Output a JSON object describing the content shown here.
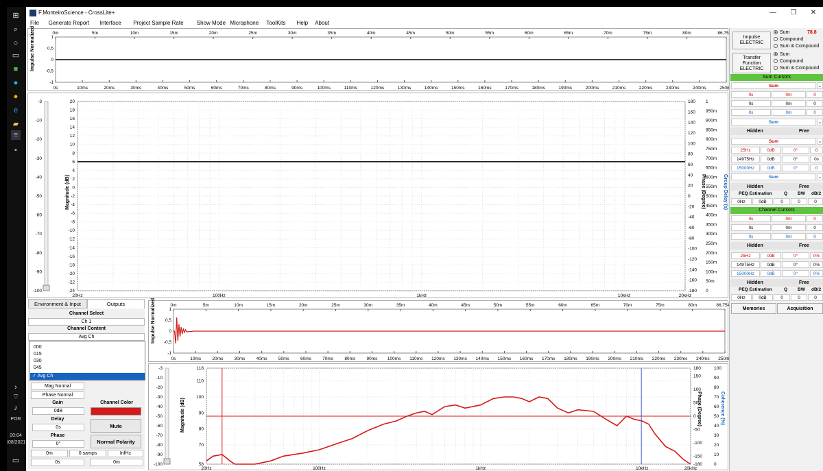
{
  "window": {
    "title": "F.MonteiroScience - CrossLite+"
  },
  "taskbar": {
    "language": "POR",
    "time": "20:04",
    "date": "/08/2021"
  },
  "menu": [
    "File",
    "Generate Report",
    "Interface",
    "Project Sample Rate",
    "Show Mode",
    "Microphone",
    "ToolKits",
    "Help",
    "About"
  ],
  "top_impulse": {
    "ylabel": "Impulse Normalized",
    "x_dist_ticks": [
      "0m",
      "5m",
      "10m",
      "15m",
      "20m",
      "25m",
      "30m",
      "35m",
      "40m",
      "45m",
      "50m",
      "55m",
      "60m",
      "65m",
      "70m",
      "75m",
      "80m",
      "86,754m"
    ],
    "x_time_ticks": [
      "0s",
      "10ms",
      "20ms",
      "30ms",
      "40ms",
      "50ms",
      "60ms",
      "70ms",
      "80ms",
      "90ms",
      "100ms",
      "110ms",
      "120ms",
      "130ms",
      "140ms",
      "150ms",
      "160ms",
      "170ms",
      "180ms",
      "190ms",
      "200ms",
      "210ms",
      "220ms",
      "230ms",
      "240ms",
      "250ms"
    ],
    "y_ticks": [
      "1",
      "0,5",
      "0",
      "-0,5",
      "-1"
    ]
  },
  "top_tf": {
    "ylabel_left": "Magnitude (dB)",
    "ylabel_right": "Phase (Degree)",
    "ylabel_right2": "Group Delay (s)",
    "y_outer_ticks": [
      "-3",
      "-10",
      "-20",
      "-30",
      "-40",
      "-50",
      "-60",
      "-70",
      "-80",
      "-90",
      "-100"
    ],
    "y_mag_ticks": [
      "20",
      "18",
      "16",
      "14",
      "12",
      "10",
      "8",
      "6",
      "4",
      "2",
      "0",
      "-2",
      "-4",
      "-6",
      "-8",
      "-10",
      "-12",
      "-14",
      "-16",
      "-18",
      "-20",
      "-22",
      "-24"
    ],
    "y_phase_ticks": [
      "180",
      "160",
      "140",
      "120",
      "100",
      "80",
      "60",
      "40",
      "20",
      "0",
      "-20",
      "-40",
      "-60",
      "-80",
      "-100",
      "-120",
      "-140",
      "-160",
      "-180"
    ],
    "y_gd_ticks": [
      "1",
      "950m",
      "900m",
      "850m",
      "800m",
      "750m",
      "700m",
      "650m",
      "600m",
      "550m",
      "500m",
      "450m",
      "400m",
      "350m",
      "300m",
      "250m",
      "200m",
      "150m",
      "100m",
      "50m",
      "0"
    ],
    "x_freq_ticks": [
      "20Hz",
      "100Hz",
      "1kHz",
      "10kHz",
      "20kHz"
    ],
    "mag_level_db": 6
  },
  "bottom_impulse": {
    "ylabel": "Impulse Normalized",
    "x_dist_ticks": [
      "0m",
      "5m",
      "10m",
      "15m",
      "20m",
      "25m",
      "30m",
      "35m",
      "40m",
      "45m",
      "50m",
      "55m",
      "60m",
      "65m",
      "70m",
      "75m",
      "80m",
      "86,754m"
    ],
    "x_time_ticks": [
      "0s",
      "10ms",
      "20ms",
      "30ms",
      "40ms",
      "50ms",
      "60ms",
      "70ms",
      "80ms",
      "90ms",
      "100ms",
      "110ms",
      "120ms",
      "130ms",
      "140ms",
      "150ms",
      "160ms",
      "170ms",
      "180ms",
      "190ms",
      "200ms",
      "210ms",
      "220ms",
      "230ms",
      "240ms",
      "250ms"
    ],
    "y_ticks": [
      "1",
      "0,5",
      "0",
      "-0,5",
      "-1"
    ]
  },
  "bottom_tf": {
    "ylabel_left": "Magnitude (dB)",
    "ylabel_right": "Phase (Degree)",
    "ylabel_right2": "Coherence (%)",
    "y_outer_ticks": [
      "-3",
      "-10",
      "-20",
      "-30",
      "-40",
      "-50",
      "-60",
      "-70",
      "-80",
      "-90",
      "-100"
    ],
    "y_mag_ticks": [
      "118",
      "110",
      "100",
      "90",
      "80",
      "70",
      "58"
    ],
    "y_phase_ticks": [
      "180",
      "150",
      "100",
      "50",
      "0",
      "-50",
      "-100",
      "-150",
      "-180"
    ],
    "y_coh_ticks": [
      "100",
      "90",
      "80",
      "70",
      "60",
      "50",
      "40",
      "30",
      "20",
      "10",
      "0"
    ],
    "x_freq_ticks": [
      "20Hz",
      "100Hz",
      "1kHz",
      "10kHz",
      "20kHz"
    ],
    "color": "#d41a1a",
    "cursor_color": "#3b5cd1"
  },
  "chart_data": {
    "type": "line",
    "x_scale": "log",
    "xlabel": "",
    "ylabel": "Magnitude (dB)",
    "xlim": [
      20,
      20000
    ],
    "ylim": [
      58,
      118
    ],
    "series": [
      {
        "x": [
          20,
          22,
          25,
          28,
          30,
          40,
          50,
          60,
          80,
          100,
          130,
          160,
          200,
          250,
          300,
          350,
          400,
          450,
          500,
          600,
          700,
          800,
          1000,
          1200,
          1400,
          1600,
          1800,
          2000,
          2300,
          2600,
          3000,
          3500,
          4000,
          5000,
          6000,
          7000,
          8000,
          9000,
          10000,
          11000,
          12000,
          14000,
          16000,
          18000,
          20000
        ],
        "y": [
          60,
          63,
          64,
          60,
          58,
          58,
          60,
          63,
          65,
          67,
          71,
          74,
          79,
          83,
          85,
          88,
          90,
          91,
          89,
          94,
          95,
          93,
          95,
          99,
          100,
          100,
          99,
          97,
          100,
          99,
          93,
          90,
          92,
          91,
          86,
          82,
          88,
          86,
          85,
          83,
          77,
          69,
          66,
          61,
          58
        ]
      }
    ]
  },
  "right_panel": {
    "impulse_btn": "Impulse ELECTRIC",
    "impulse_radio": [
      "Sum",
      "Compound",
      "Sum & Compound"
    ],
    "impulse_value": "78.8",
    "tf_btn": "Transfer Function ELECTRIC",
    "tf_radio": [
      "Sum",
      "Compound",
      "Sum & Compound"
    ],
    "sum_cursors": "Sum Cursors",
    "sum": "Sum",
    "c1": [
      "0s",
      "0m",
      "0"
    ],
    "c2": [
      "0s",
      "0m",
      "0"
    ],
    "c3": [
      "0s",
      "0m",
      "0"
    ],
    "hidden": "Hidden",
    "free": "Free",
    "f1": [
      "25Hz",
      "0dB",
      "0°",
      "0"
    ],
    "f2": [
      "14975Hz",
      "0dB",
      "0°",
      "0s"
    ],
    "f3": [
      "15000Hz",
      "0dB",
      "0°",
      "0"
    ],
    "peq": "PEQ Estimation",
    "peq_cols": [
      "Q",
      "BW",
      "dB/2"
    ],
    "peq_vals": [
      "0Hz",
      "0dB",
      "0",
      "0",
      "0"
    ],
    "channel_cursors": "Channel Cursors",
    "cf1": [
      "25Hz",
      "0dB",
      "0°",
      "0%"
    ],
    "cf2": [
      "14975Hz",
      "0dB",
      "0°",
      "0%"
    ],
    "cf3": [
      "15000Hz",
      "0dB",
      "0°",
      "0%"
    ],
    "memories": "Memories",
    "acquisition": "Acquisition"
  },
  "left_panel": {
    "tab1": "Environment & Input",
    "tab2": "Outputs",
    "channel_select_label": "Channel Select",
    "channel_select": "Ch 1",
    "channel_content_label": "Channel Content",
    "channel_content": "Avg Ch",
    "options": [
      "000",
      "015",
      "030",
      "045",
      "Avg Ch"
    ],
    "mag_mode": "Mag Normal",
    "phase_mode": "Phase Normal",
    "gain_label": "Gain",
    "gain": "0dB",
    "delay_label": "Delay",
    "delay": "0s",
    "phase_label": "Phase",
    "phase": "0°",
    "channel_color_label": "Channel Color",
    "channel_color": "#d41a1a",
    "mute": "Mute",
    "polarity": "Normal Polarity",
    "footer": [
      "0m",
      "0 samps",
      "InfHz",
      "0s",
      "0m"
    ]
  }
}
